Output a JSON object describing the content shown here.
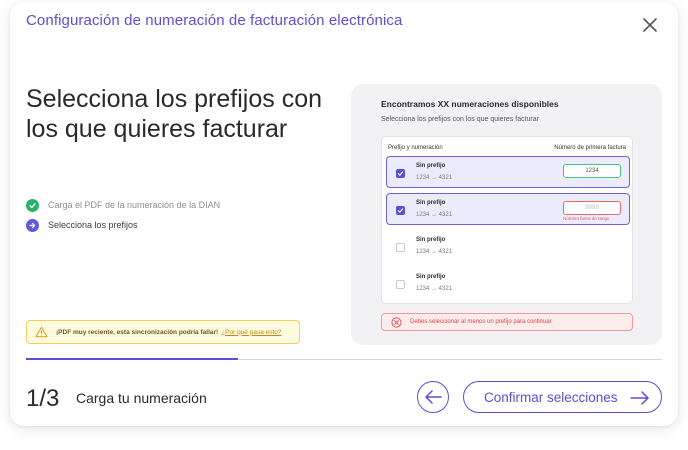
{
  "header": {
    "title": "Configuración de numeración de facturación electrónica"
  },
  "main": {
    "title": "Selecciona los prefijos con los que quieres facturar"
  },
  "steps": [
    {
      "label": "Carga el PDF de la numeración de la DIAN",
      "state": "done"
    },
    {
      "label": "Selecciona los prefijos",
      "state": "current"
    }
  ],
  "warning": {
    "message": "¡PDF muy reciente, esta sincronización podría fallar!",
    "link": "¿Por qué pasa esto?"
  },
  "preview": {
    "title": "Encontramos XX numeraciones disponibles",
    "subtitle": "Selecciona los prefijos con los que quieres facturar",
    "col_prefix": "Prefijo y numeración",
    "col_first": "Número de primera factura",
    "rows": [
      {
        "name": "Sin prefijo",
        "range": "1234 → 4321",
        "checked": true,
        "value": "1234",
        "error": ""
      },
      {
        "name": "Sin prefijo",
        "range": "1234 → 4321",
        "checked": true,
        "value": "9999",
        "error": "Número fuera de rango"
      },
      {
        "name": "Sin prefijo",
        "range": "1234 → 4321",
        "checked": false
      },
      {
        "name": "Sin prefijo",
        "range": "1234 → 4321",
        "checked": false
      }
    ],
    "error": "Debes seleccionar al menos un prefijo para continuar"
  },
  "progress": {
    "fraction": 0.333
  },
  "footer": {
    "step_count": "1/3",
    "step_name": "Carga tu numeración",
    "confirm_label": "Confirmar selecciones"
  },
  "colors": {
    "accent": "#5b4fd6",
    "success": "#29b36a",
    "warning": "#f3cf57",
    "error": "#e6696d"
  },
  "icons": [
    "close-icon",
    "check-circle-icon",
    "arrow-right-circle-icon",
    "warning-triangle-icon",
    "checkbox-check-icon",
    "error-x-circle-icon",
    "arrow-left-icon",
    "arrow-right-icon"
  ]
}
